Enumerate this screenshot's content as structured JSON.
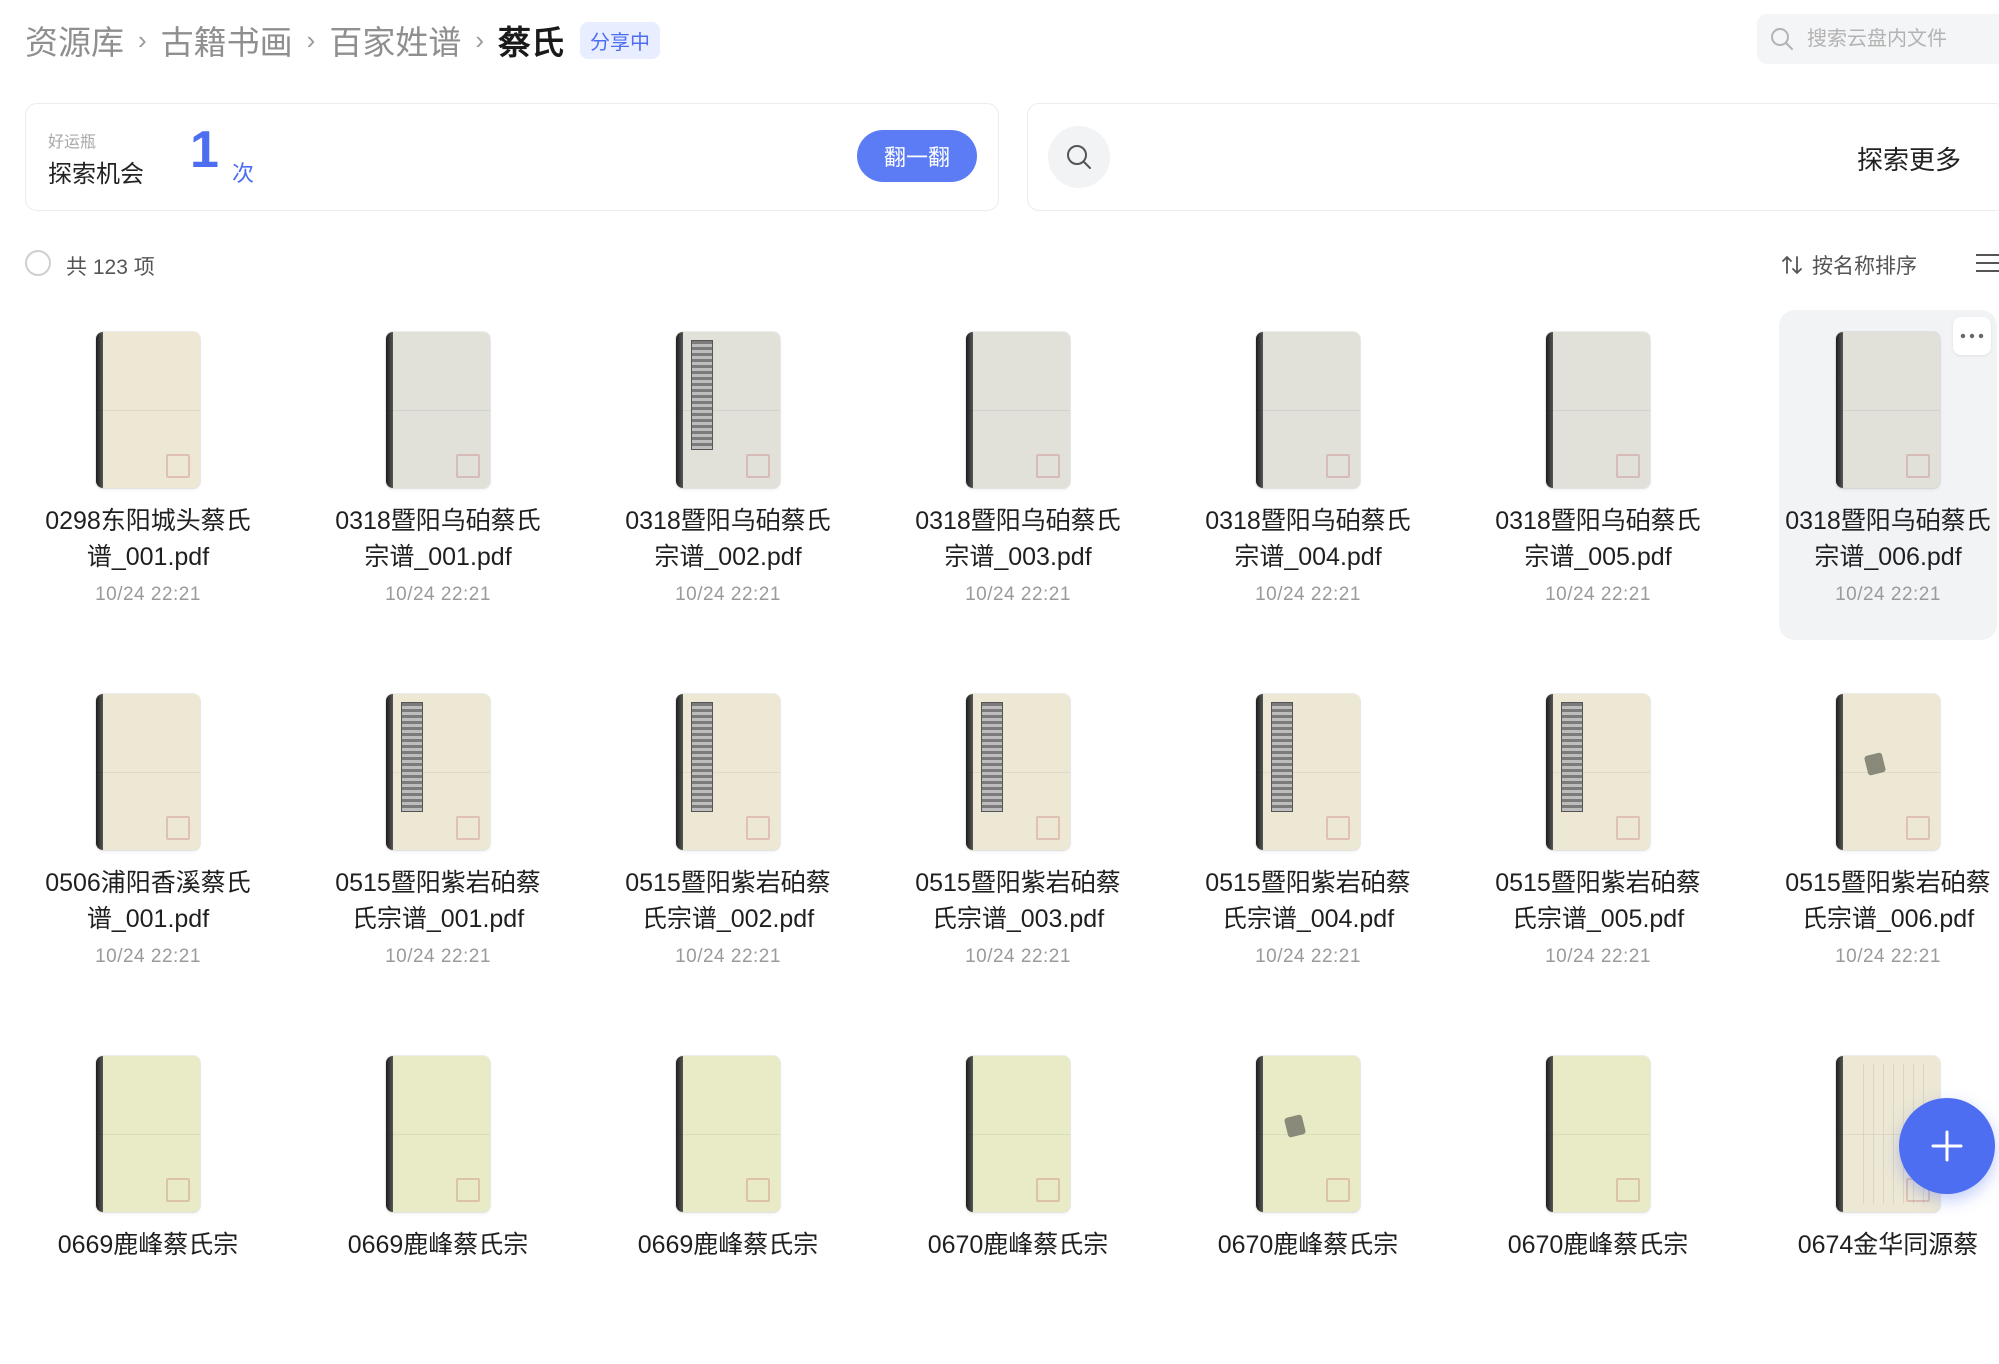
{
  "breadcrumb": {
    "items": [
      "资源库",
      "古籍书画",
      "百家姓谱"
    ],
    "current": "蔡氏",
    "badge": "分享中"
  },
  "search": {
    "placeholder": "搜索云盘内文件"
  },
  "lucky": {
    "small_label": "好运瓶",
    "label": "探索机会",
    "count": "1",
    "unit": "次",
    "button": "翻一翻"
  },
  "explore": {
    "label": "探索更多"
  },
  "toolbar": {
    "count_text": "共 123 项",
    "sort_label": "按名称排序"
  },
  "files": [
    {
      "name": "0298东阳城头蔡氏谱_001.pdf",
      "date": "10/24 22:21",
      "thumb": "cream"
    },
    {
      "name": "0318暨阳乌砶蔡氏宗谱_001.pdf",
      "date": "10/24 22:21",
      "thumb": "gray"
    },
    {
      "name": "0318暨阳乌砶蔡氏宗谱_002.pdf",
      "date": "10/24 22:21",
      "thumb": "gray-title"
    },
    {
      "name": "0318暨阳乌砶蔡氏宗谱_003.pdf",
      "date": "10/24 22:21",
      "thumb": "gray"
    },
    {
      "name": "0318暨阳乌砶蔡氏宗谱_004.pdf",
      "date": "10/24 22:21",
      "thumb": "gray"
    },
    {
      "name": "0318暨阳乌砶蔡氏宗谱_005.pdf",
      "date": "10/24 22:21",
      "thumb": "gray"
    },
    {
      "name": "0318暨阳乌砶蔡氏宗谱_006.pdf",
      "date": "10/24 22:21",
      "thumb": "gray",
      "selected": true
    },
    {
      "name": "0506浦阳香溪蔡氏谱_001.pdf",
      "date": "10/24 22:21",
      "thumb": "cream"
    },
    {
      "name": "0515暨阳紫岩砶蔡氏宗谱_001.pdf",
      "date": "10/24 22:21",
      "thumb": "cream-title"
    },
    {
      "name": "0515暨阳紫岩砶蔡氏宗谱_002.pdf",
      "date": "10/24 22:21",
      "thumb": "cream-title"
    },
    {
      "name": "0515暨阳紫岩砶蔡氏宗谱_003.pdf",
      "date": "10/24 22:21",
      "thumb": "cream-title"
    },
    {
      "name": "0515暨阳紫岩砶蔡氏宗谱_004.pdf",
      "date": "10/24 22:21",
      "thumb": "cream-title"
    },
    {
      "name": "0515暨阳紫岩砶蔡氏宗谱_005.pdf",
      "date": "10/24 22:21",
      "thumb": "cream-title"
    },
    {
      "name": "0515暨阳紫岩砶蔡氏宗谱_006.pdf",
      "date": "10/24 22:21",
      "thumb": "cream-stain"
    },
    {
      "name": "0669鹿峰蔡氏宗",
      "date": "",
      "thumb": "yellow"
    },
    {
      "name": "0669鹿峰蔡氏宗",
      "date": "",
      "thumb": "yellow"
    },
    {
      "name": "0669鹿峰蔡氏宗",
      "date": "",
      "thumb": "yellow"
    },
    {
      "name": "0670鹿峰蔡氏宗",
      "date": "",
      "thumb": "yellow"
    },
    {
      "name": "0670鹿峰蔡氏宗",
      "date": "",
      "thumb": "yellow-stain"
    },
    {
      "name": "0670鹿峰蔡氏宗",
      "date": "",
      "thumb": "yellow"
    },
    {
      "name": "0674金华同源蔡",
      "date": "",
      "thumb": "cream-lines"
    }
  ],
  "colors": {
    "accent": "#4e6ef2",
    "badge_bg": "#e8edff",
    "button_bg": "#5b7cf5"
  },
  "icons": {
    "search": "search-icon",
    "explore": "magnifier-icon",
    "sort": "sort-arrows-icon",
    "view": "list-view-icon",
    "more": "more-dots-icon",
    "fab": "plus-icon"
  }
}
